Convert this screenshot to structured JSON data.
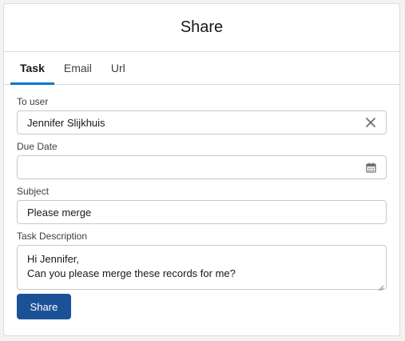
{
  "header": {
    "title": "Share"
  },
  "tabs": [
    {
      "label": "Task",
      "active": true
    },
    {
      "label": "Email",
      "active": false
    },
    {
      "label": "Url",
      "active": false
    }
  ],
  "form": {
    "to_user": {
      "label": "To user",
      "value": "Jennifer Slijkhuis",
      "icon": "close-icon"
    },
    "due_date": {
      "label": "Due Date",
      "value": "",
      "icon": "calendar-icon"
    },
    "subject": {
      "label": "Subject",
      "value": "Please merge"
    },
    "description": {
      "label": "Task Description",
      "lines": [
        "Hi Jennifer,",
        "Can you please merge these records for me?"
      ]
    },
    "submit_label": "Share"
  },
  "colors": {
    "accent": "#0176d3",
    "button": "#1b5297",
    "border": "#c9c9c9"
  }
}
